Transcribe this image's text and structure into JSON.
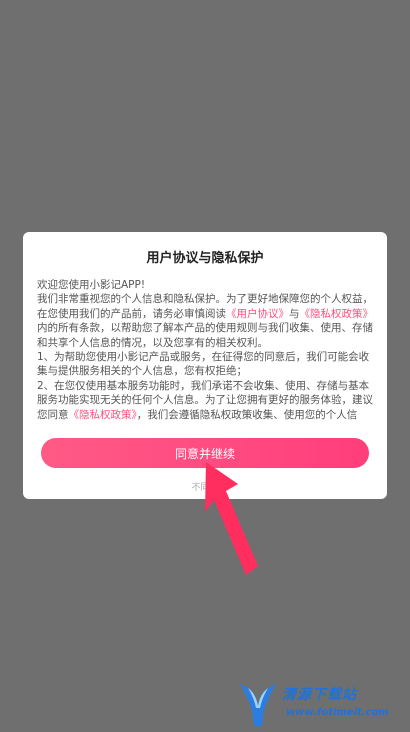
{
  "dialog": {
    "title": "用户协议与隐私保护",
    "paragraphs": [
      {
        "segments": [
          {
            "text": "欢迎您使用小影记APP!"
          }
        ]
      },
      {
        "segments": [
          {
            "text": "我们非常重视您的个人信息和隐私保护。为了更好地保障您的个人权益，在您使用我们的产品前，请务必审慎阅读"
          },
          {
            "text": "《用户协议》",
            "link": true
          },
          {
            "text": "与"
          },
          {
            "text": "《隐私权政策》",
            "link": true
          },
          {
            "text": "内的所有条款，以帮助您了解本产品的使用规则与我们收集、使用、存储和共享个人信息的情况，以及您享有的相关权利。"
          }
        ]
      },
      {
        "segments": [
          {
            "text": "1、为帮助您使用小影记产品或服务，在征得您的同意后，我们可能会收集与提供服务相关的个人信息，您有权拒绝；"
          }
        ]
      },
      {
        "segments": [
          {
            "text": "2、在您仅使用基本服务功能时，我们承诺不会收集、使用、存储与基本服务功能实现无关的任何个人信息。为了让您拥有更好的服务体验，建议您同意"
          },
          {
            "text": "《隐私权政策》",
            "link": true
          },
          {
            "text": "，我们会遵循隐私权政策收集、使用您的个人信息。"
          }
        ]
      }
    ],
    "agree_label": "同意并继续",
    "disagree_label": "不同意"
  },
  "watermark": {
    "name": "清源下载站",
    "url": "www.fotimeit.com"
  },
  "colors": {
    "accent": "#ff3e7c",
    "overlay": "#6f6f6f",
    "arrow": "#ff2e5e",
    "watermark": "#1e73d8"
  }
}
